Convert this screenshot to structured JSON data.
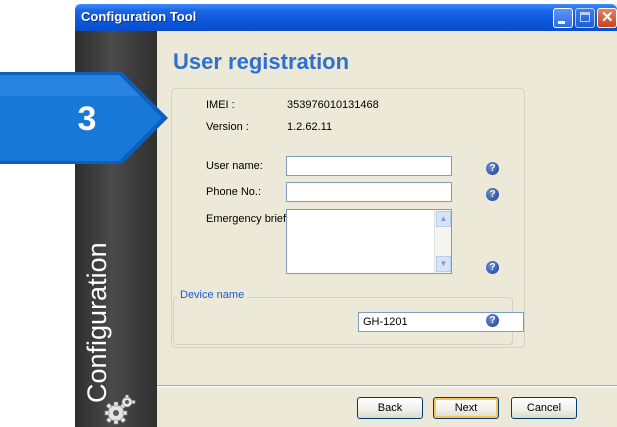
{
  "window": {
    "title": "Configuration Tool"
  },
  "badge": {
    "number": "3",
    "color": "#1878d8"
  },
  "sidebar": {
    "label": "Configuration",
    "icon": "gears-icon"
  },
  "page": {
    "title": "User registration"
  },
  "device_info": {
    "imei_label": "IMEI :",
    "imei_value": "353976010131468",
    "version_label": "Version :",
    "version_value": "1.2.62.11"
  },
  "form": {
    "user_name_label": "User name:",
    "user_name_value": "",
    "phone_label": "Phone No.:",
    "phone_value": "",
    "emergency_label": "Emergency brief:",
    "emergency_value": "",
    "help_glyph": "?"
  },
  "device_group": {
    "legend": "Device name",
    "value": "GH-1201"
  },
  "buttons": {
    "back": "Back",
    "next": "Next",
    "cancel": "Cancel"
  },
  "colors": {
    "title_blue": "#2f6fce",
    "titlebar": "#0b55d8",
    "accent_legend": "#1d58d6"
  }
}
